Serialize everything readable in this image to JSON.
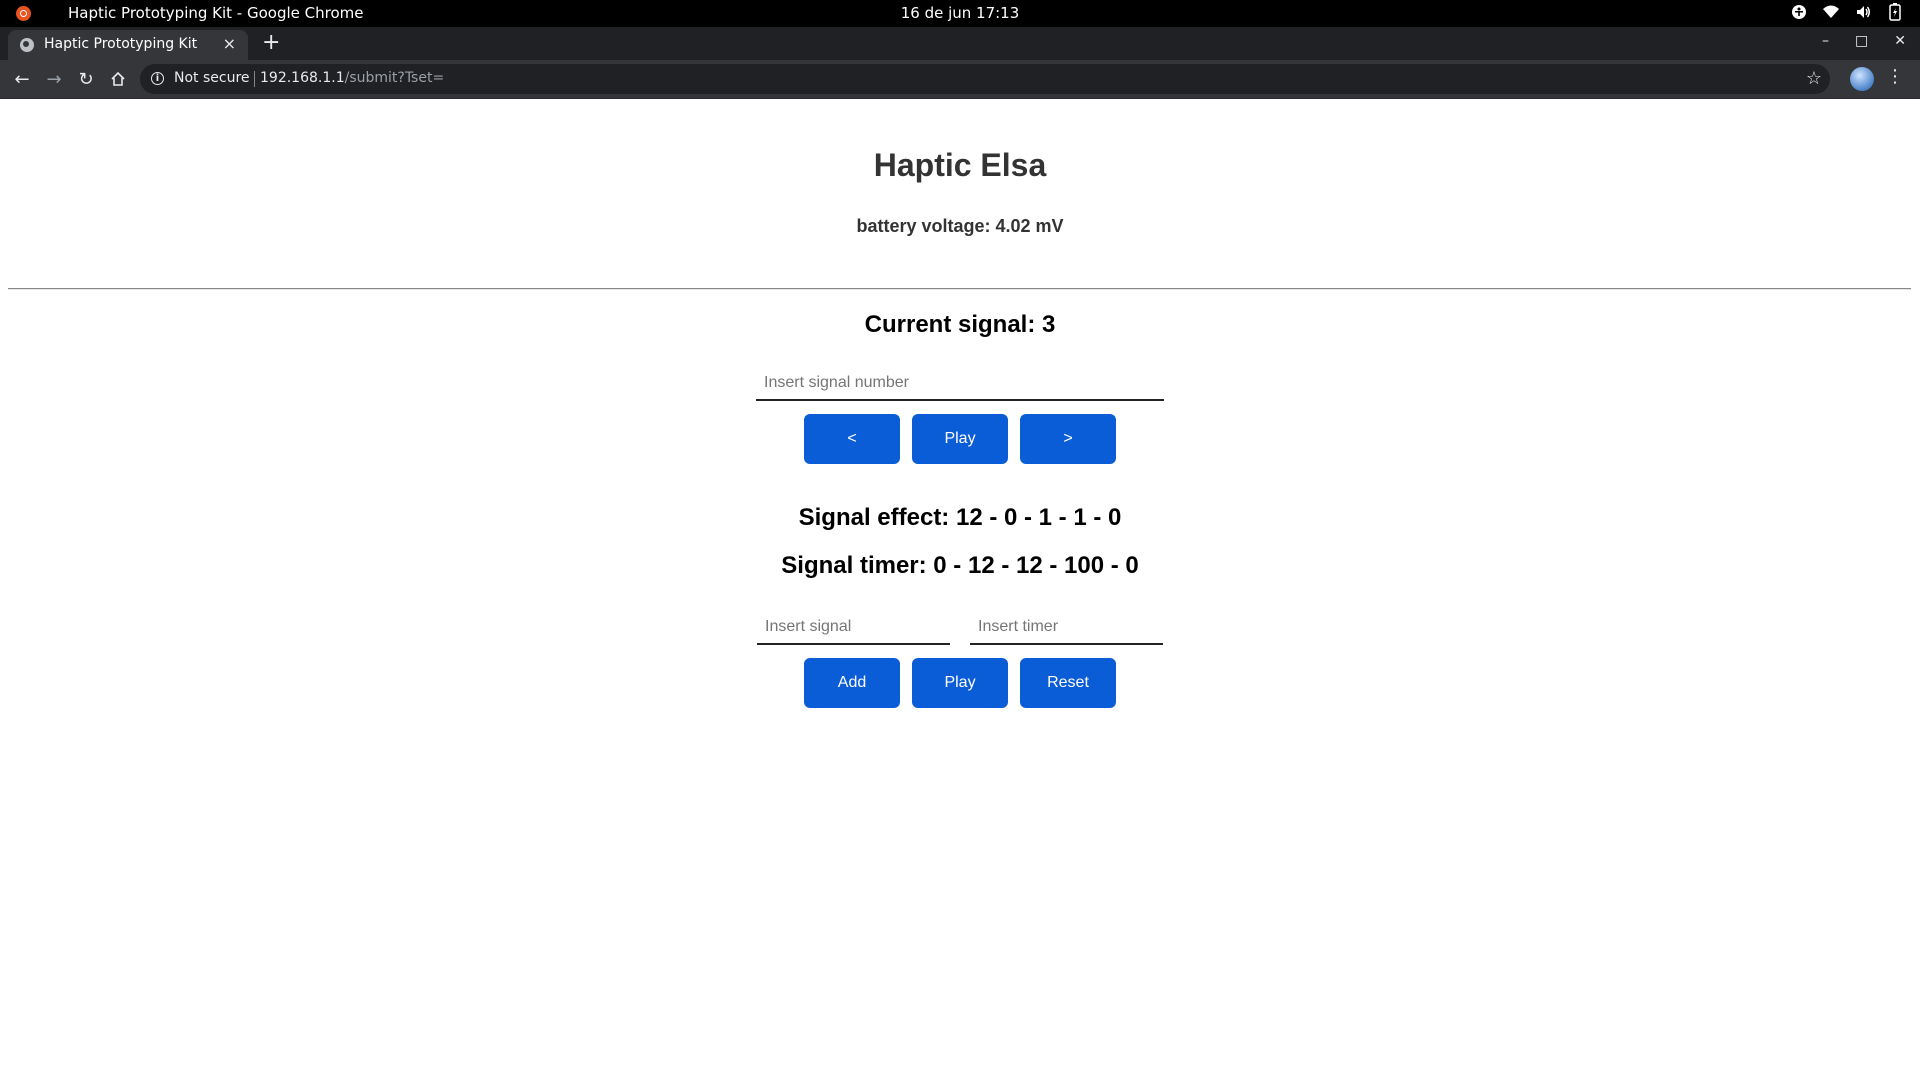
{
  "os": {
    "window_title": "Haptic Prototyping Kit - Google Chrome",
    "clock": "16 de jun  17:13",
    "tray_icons": [
      "accessibility-icon",
      "wifi-icon",
      "volume-icon",
      "battery-icon"
    ]
  },
  "browser": {
    "tab_title": "Haptic Prototyping Kit",
    "tab_close": "×",
    "new_tab": "+",
    "not_secure": "Not secure",
    "url_host": "192.168.1.1",
    "url_path": "/submit?Tset="
  },
  "page": {
    "title": "Haptic Elsa",
    "battery": "battery voltage: 4.02 mV",
    "current_signal": "Current signal: 3",
    "signal_number_placeholder": "Insert signal number",
    "prev_label": "<",
    "play_label": "Play",
    "next_label": ">",
    "signal_effect": "Signal effect: 12 - 0 - 1 - 1 - 0",
    "signal_timer": "Signal timer: 0 - 12 - 12 - 100 - 0",
    "signal_placeholder": "Insert signal",
    "timer_placeholder": "Insert timer",
    "add_label": "Add",
    "play2_label": "Play",
    "reset_label": "Reset"
  },
  "colors": {
    "button_bg": "#0b5cd7",
    "os_bar": "#000000",
    "tab_strip": "#202124",
    "toolbar": "#35363a"
  }
}
